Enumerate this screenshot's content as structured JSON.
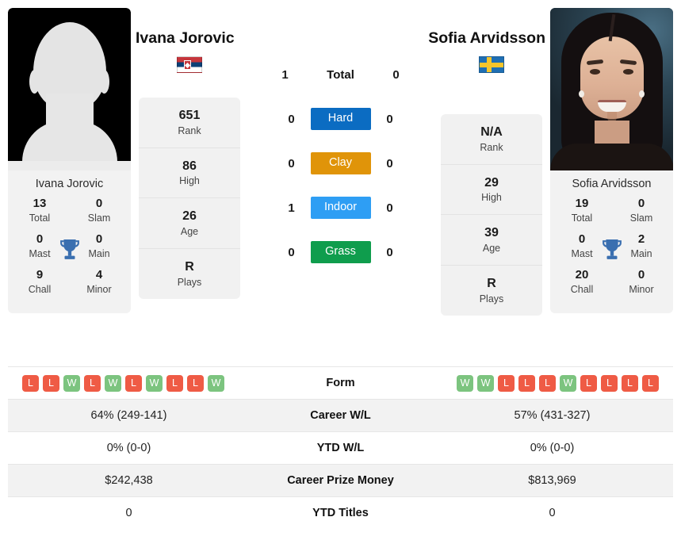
{
  "players": {
    "left": {
      "name": "Ivana Jorovic",
      "card_name": "Ivana Jorovic",
      "country_flag": "flag-serbia",
      "photo": "placeholder-avatar",
      "titles": [
        {
          "value": "13",
          "label": "Total"
        },
        {
          "value": "0",
          "label": "Slam"
        },
        {
          "value": "0",
          "label": "Mast"
        },
        {
          "value": "0",
          "label": "Main"
        },
        {
          "value": "9",
          "label": "Chall"
        },
        {
          "value": "4",
          "label": "Minor"
        }
      ],
      "stats": [
        {
          "value": "651",
          "label": "Rank"
        },
        {
          "value": "86",
          "label": "High"
        },
        {
          "value": "26",
          "label": "Age"
        },
        {
          "value": "R",
          "label": "Plays"
        }
      ],
      "form": [
        "L",
        "L",
        "W",
        "L",
        "W",
        "L",
        "W",
        "L",
        "L",
        "W"
      ],
      "career_wl": "64% (249-141)",
      "ytd_wl": "0% (0-0)",
      "career_prize_money": "$242,438",
      "ytd_titles": "0"
    },
    "right": {
      "name": "Sofia Arvidsson",
      "card_name": "Sofia Arvidsson",
      "country_flag": "flag-sweden",
      "photo": "player-portrait",
      "titles": [
        {
          "value": "19",
          "label": "Total"
        },
        {
          "value": "0",
          "label": "Slam"
        },
        {
          "value": "0",
          "label": "Mast"
        },
        {
          "value": "2",
          "label": "Main"
        },
        {
          "value": "20",
          "label": "Chall"
        },
        {
          "value": "0",
          "label": "Minor"
        }
      ],
      "stats": [
        {
          "value": "N/A",
          "label": "Rank"
        },
        {
          "value": "29",
          "label": "High"
        },
        {
          "value": "39",
          "label": "Age"
        },
        {
          "value": "R",
          "label": "Plays"
        }
      ],
      "form": [
        "W",
        "W",
        "L",
        "L",
        "L",
        "W",
        "L",
        "L",
        "L",
        "L"
      ],
      "career_wl": "57% (431-327)",
      "ytd_wl": "0% (0-0)",
      "career_prize_money": "$813,969",
      "ytd_titles": "0"
    }
  },
  "head_to_head": {
    "total": {
      "label": "Total",
      "left": "1",
      "right": "0"
    },
    "surfaces": [
      {
        "label": "Hard",
        "left": "0",
        "right": "0",
        "color": "#0b6cc2"
      },
      {
        "label": "Clay",
        "left": "0",
        "right": "0",
        "color": "#e09409"
      },
      {
        "label": "Indoor",
        "left": "1",
        "right": "0",
        "color": "#2e9ef4"
      },
      {
        "label": "Grass",
        "left": "0",
        "right": "0",
        "color": "#0f9d4d"
      }
    ]
  },
  "table": {
    "rows": [
      {
        "label": "Form",
        "left": "",
        "right": ""
      },
      {
        "label": "Career W/L",
        "left": "64% (249-141)",
        "right": "57% (431-327)"
      },
      {
        "label": "YTD W/L",
        "left": "0% (0-0)",
        "right": "0% (0-0)"
      },
      {
        "label": "Career Prize Money",
        "left": "$242,438",
        "right": "$813,969"
      },
      {
        "label": "YTD Titles",
        "left": "0",
        "right": "0"
      }
    ]
  },
  "colors": {
    "win_badge": "#7cc47f",
    "loss_badge": "#ef5b45",
    "trophy": "#3a6fb0",
    "card_bg": "#f1f1f1"
  }
}
